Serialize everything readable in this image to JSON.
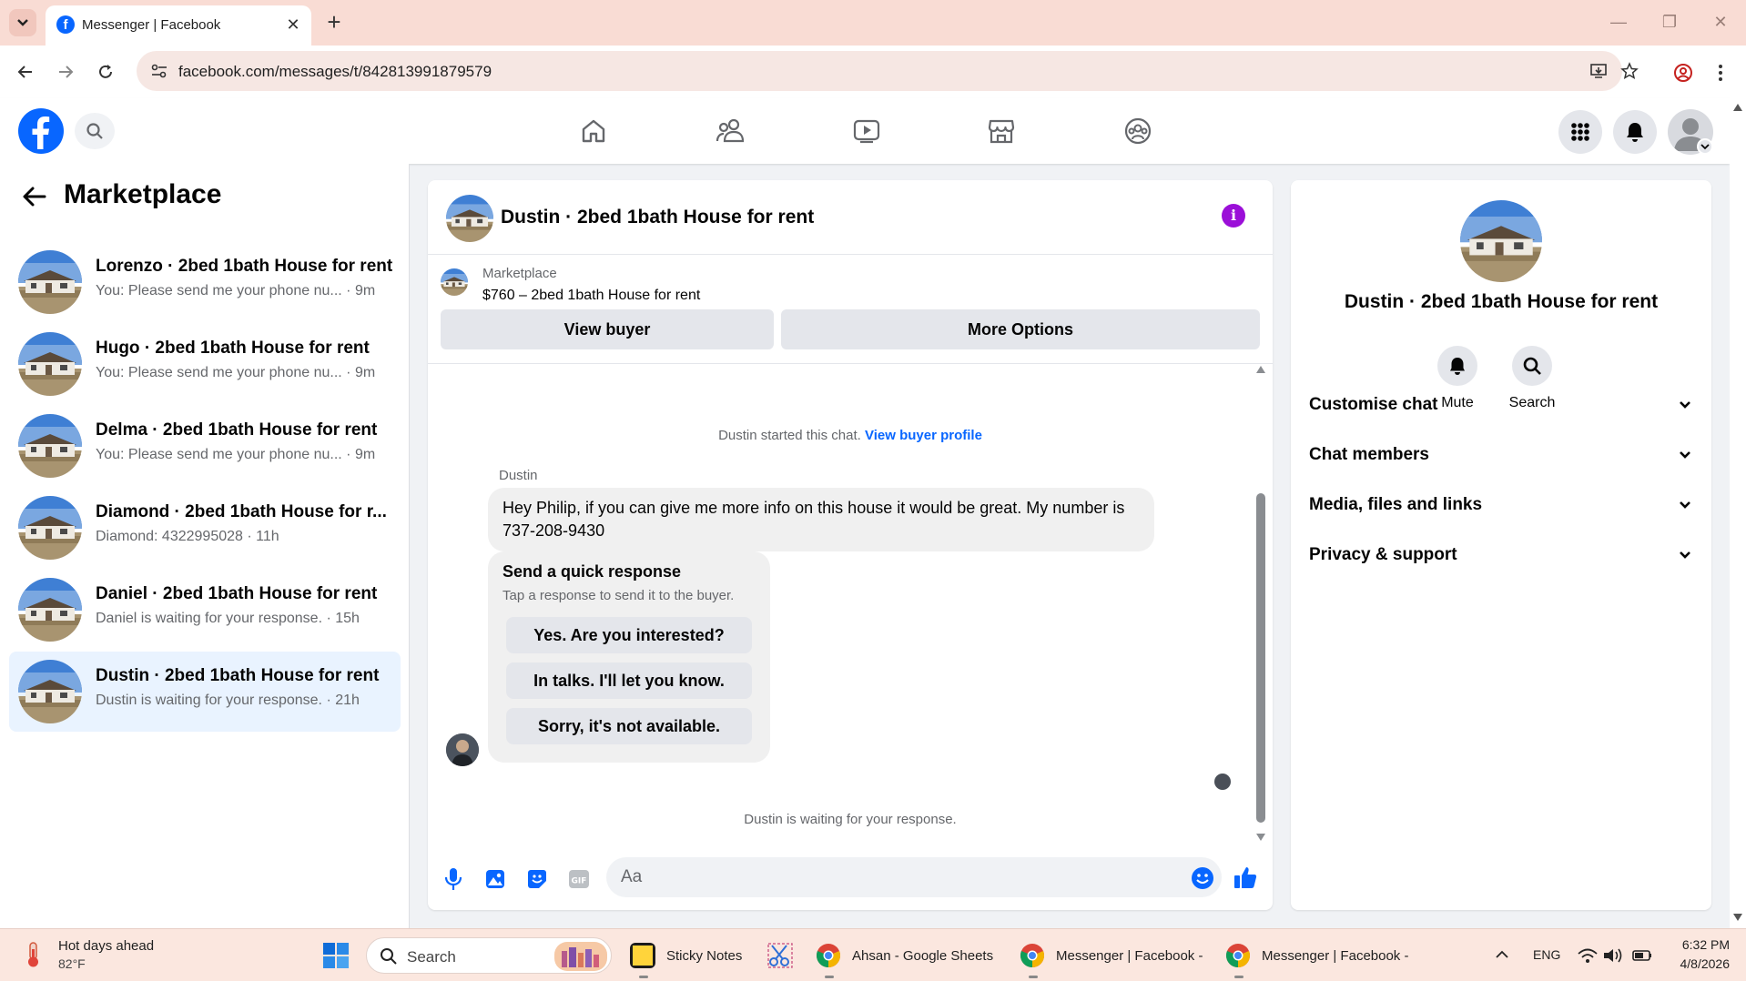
{
  "browser": {
    "tab_title": "Messenger | Facebook",
    "url": "facebook.com/messages/t/842813991879579"
  },
  "left": {
    "title": "Marketplace",
    "conversations": [
      {
        "name": "Lorenzo · 2bed 1bath House for rent",
        "preview": "You: Please send me your phone nu...",
        "time": "· 9m"
      },
      {
        "name": "Hugo · 2bed 1bath House for rent",
        "preview": "You: Please send me your phone nu...",
        "time": "· 9m"
      },
      {
        "name": "Delma · 2bed 1bath House for rent",
        "preview": "You: Please send me your phone nu...",
        "time": "· 9m"
      },
      {
        "name": "Diamond · 2bed 1bath House for r...",
        "preview": "Diamond: 4322995028",
        "time": "· 11h"
      },
      {
        "name": "Daniel · 2bed 1bath House for rent",
        "preview": "Daniel is waiting for your response.",
        "time": "· 15h"
      },
      {
        "name": "Dustin · 2bed 1bath House for rent",
        "preview": "Dustin is waiting for your response.",
        "time": "· 21h"
      }
    ]
  },
  "chat": {
    "title": "Dustin · 2bed 1bath House for rent",
    "marketplace_label": "Marketplace",
    "listing": "$760 – 2bed 1bath House for rent",
    "view_buyer": "View buyer",
    "more_options": "More Options",
    "system_text": "Dustin started this chat.",
    "system_link": "View buyer profile",
    "sender": "Dustin",
    "message": "Hey Philip, if you can give me more info on this house it would be great. My number is 737-208-9430",
    "quick_title": "Send a quick response",
    "quick_sub": "Tap a response to send it to the buyer.",
    "quick_options": [
      "Yes. Are you interested?",
      "In talks. I'll let you know.",
      "Sorry, it's not available."
    ],
    "waiting": "Dustin is waiting for your response.",
    "input_placeholder": "Aa"
  },
  "right": {
    "name": "Dustin · 2bed 1bath House for rent",
    "mute": "Mute",
    "search": "Search",
    "sections": [
      "Customise chat",
      "Chat members",
      "Media, files and links",
      "Privacy & support"
    ]
  },
  "taskbar": {
    "weather_title": "Hot days ahead",
    "weather_temp": "82°F",
    "search": "Search",
    "apps": [
      {
        "label": "Sticky Notes"
      },
      {
        "label": "Ahsan - Google Sheets"
      },
      {
        "label": "Messenger | Facebook -"
      },
      {
        "label": "Messenger | Facebook -"
      }
    ],
    "lang": "ENG",
    "time": "6:32 PM",
    "date": "4/8/2026"
  },
  "colors": {
    "fb_blue": "#0866ff",
    "info_purple": "#9b0fd8",
    "active_row": "#e9f3ff"
  }
}
